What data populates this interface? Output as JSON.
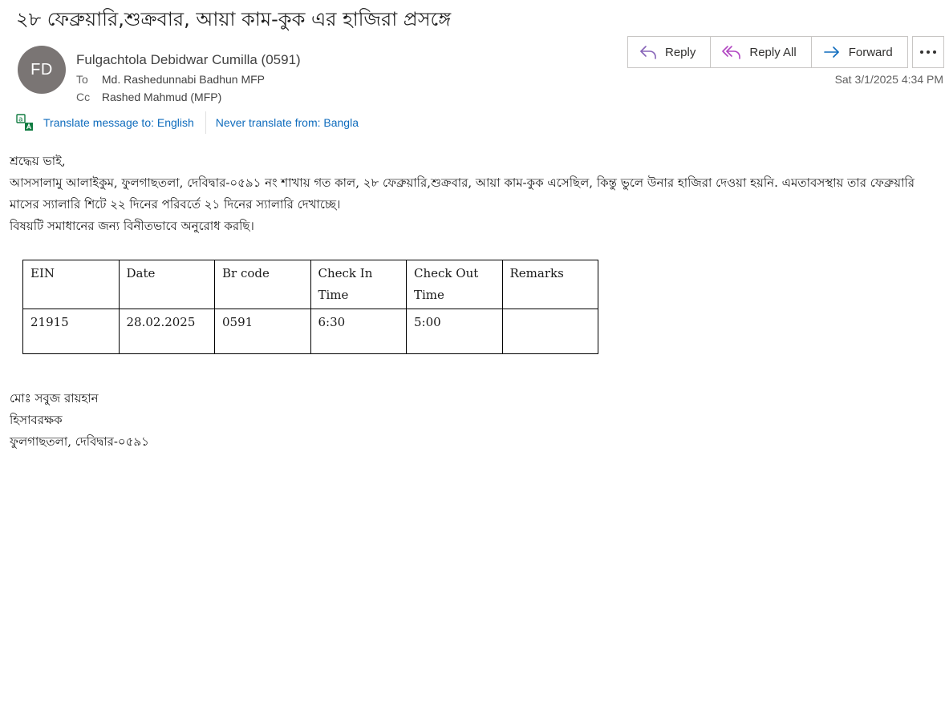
{
  "email": {
    "subject": "২৮ ফেব্রুয়ারি,শুক্রবার, আয়া কাম-কুক এর হাজিরা প্রসঙ্গে",
    "avatar_initials": "FD",
    "sender": "Fulgachtola Debidwar Cumilla (0591)",
    "to_label": "To",
    "to_value": "Md. Rashedunnabi Badhun MFP",
    "cc_label": "Cc",
    "cc_value": "Rashed Mahmud (MFP)",
    "date": "Sat 3/1/2025 4:34 PM"
  },
  "actions": {
    "reply": "Reply",
    "reply_all": "Reply All",
    "forward": "Forward",
    "more_icon": "more-horizontal-icon"
  },
  "translate": {
    "translate_label": "Translate message to: English",
    "never_label": "Never translate from: Bangla"
  },
  "body": {
    "greeting": "শ্রদ্ধেয় ভাই,",
    "para1": "আসসালামু আলাইকুম, ফুলগাছতলা, দেবিদ্বার-০৫৯১ নং শাখায় গত কাল, ২৮ ফেব্রুয়ারি,শুক্রবার, আয়া কাম-কুক এসেছিল, কিন্তু ভুলে উনার হাজিরা দেওয়া হয়নি. এমতাবসস্থায় তার ফেব্রুয়ারি মাসের স্যালারি শিটে ২২ দিনের পরিবর্তে ২১ দিনের স্যালারি দেখাচ্ছে।",
    "para2": "বিষয়টি সমাধানের জন্য বিনীতভাবে অনুরোধ করছি।"
  },
  "table": {
    "headers": [
      "EIN",
      "Date",
      "Br code",
      "Check In Time",
      "Check Out Time",
      "Remarks"
    ],
    "row": [
      "21915",
      "28.02.2025",
      "0591",
      "6:30",
      "5:00",
      ""
    ]
  },
  "signature": {
    "name": "মোঃ সবুজ রায়হান",
    "title": "হিসাবরক্ষক",
    "branch": "ফুলগাছতলা, দেবিদ্বার-০৫৯১"
  },
  "colors": {
    "link": "#0f6cbd",
    "reply_icon": "#8764b8",
    "reply_all_icon": "#b146c2",
    "forward_icon": "#0f6cbd",
    "avatar_bg": "#7a7574"
  }
}
